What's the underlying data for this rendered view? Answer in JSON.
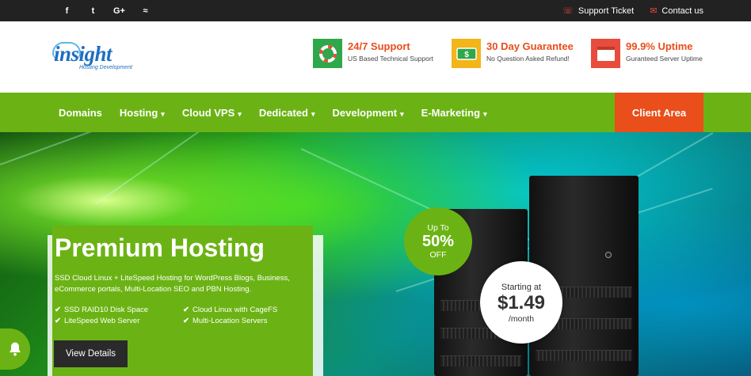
{
  "topbar": {
    "social": [
      {
        "icon": "facebook-icon",
        "glyph": "f"
      },
      {
        "icon": "twitter-icon",
        "glyph": "t"
      },
      {
        "icon": "google-plus-icon",
        "glyph": "G+"
      },
      {
        "icon": "rss-icon",
        "glyph": "≈"
      }
    ],
    "support_ticket": "Support Ticket",
    "contact_us": "Contact us"
  },
  "header": {
    "logo_word": "insight",
    "logo_tagline": "Hosting Development",
    "features": [
      {
        "icon": "lifebuoy-icon",
        "title": "24/7 Support",
        "subtitle": "US Based Technical Support",
        "color": "#2ea84a"
      },
      {
        "icon": "money-icon",
        "title": "30 Day Guarantee",
        "subtitle": "No Question Asked Refund!",
        "color": "#f2b51a"
      },
      {
        "icon": "browser-icon",
        "title": "99.9% Uptime",
        "subtitle": "Guranteed Server Uptime",
        "color": "#e74c3c"
      }
    ]
  },
  "nav": {
    "items": [
      {
        "label": "Domains",
        "dropdown": false
      },
      {
        "label": "Hosting",
        "dropdown": true
      },
      {
        "label": "Cloud VPS",
        "dropdown": true
      },
      {
        "label": "Dedicated",
        "dropdown": true
      },
      {
        "label": "Development",
        "dropdown": true
      },
      {
        "label": "E-Marketing",
        "dropdown": true
      }
    ],
    "client_area": "Client Area"
  },
  "hero": {
    "title": "Premium Hosting",
    "description": "SSD Cloud Linux + LiteSpeed Hosting for WordPress Blogs, Business, eCommerce portals, Multi-Location SEO and PBN Hosting.",
    "features": [
      "SSD RAID10 Disk Space",
      "Cloud Linux with CageFS",
      "LiteSpeed Web Server",
      "Multi-Location Servers"
    ],
    "button": "View Details",
    "badge": {
      "line1": "Up To",
      "line2": "50%",
      "line3": "OFF"
    },
    "price": {
      "line1": "Starting at",
      "amount": "$1.49",
      "per": "/month"
    }
  },
  "colors": {
    "brand_green": "#6bb314",
    "accent_orange": "#e94e1b",
    "topbar": "#222222"
  }
}
